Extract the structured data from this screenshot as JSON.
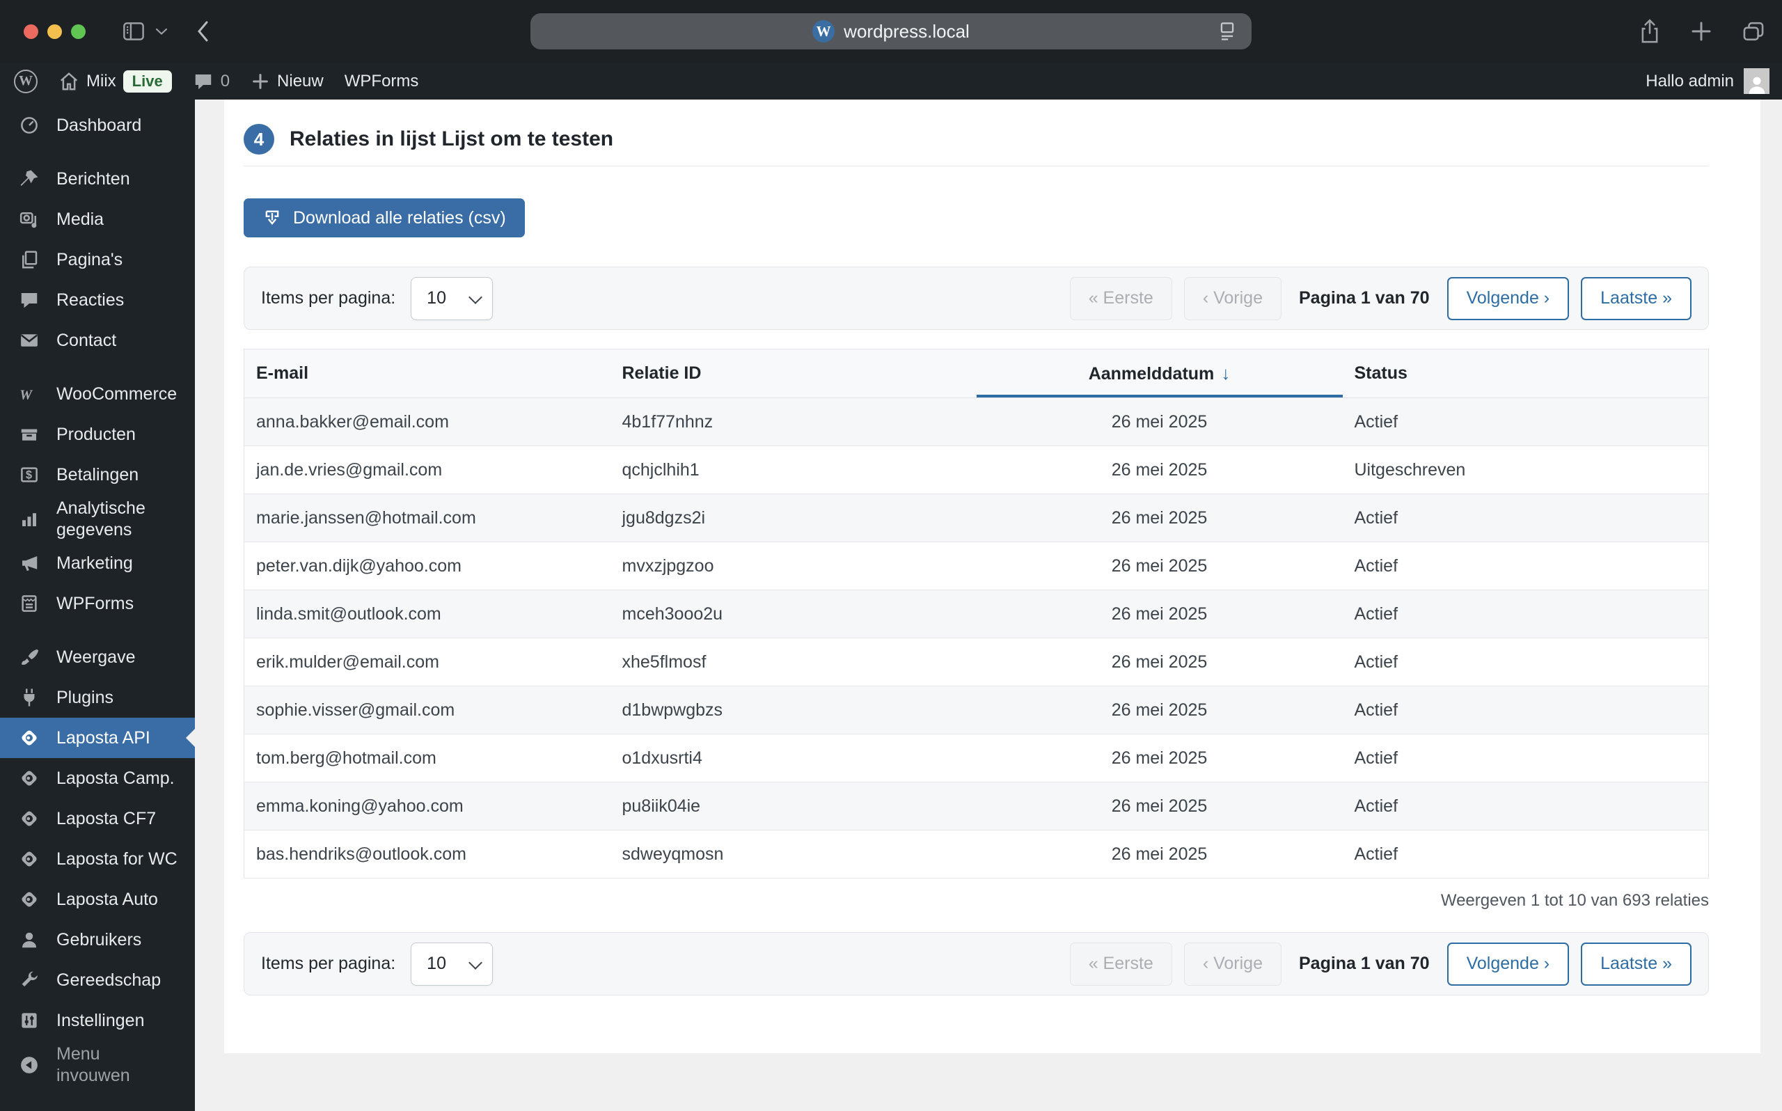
{
  "browser": {
    "url": "wordpress.local"
  },
  "admin_bar": {
    "site_name": "Miix",
    "live_badge": "Live",
    "comment_count": "0",
    "new_label": "Nieuw",
    "wpforms_label": "WPForms",
    "greeting": "Hallo admin"
  },
  "sidebar": {
    "items": [
      {
        "label": "Dashboard",
        "icon": "dashboard"
      },
      {
        "label": "Berichten",
        "icon": "pin",
        "gap_before": true
      },
      {
        "label": "Media",
        "icon": "media"
      },
      {
        "label": "Pagina's",
        "icon": "pages"
      },
      {
        "label": "Reacties",
        "icon": "bubble"
      },
      {
        "label": "Contact",
        "icon": "mail"
      },
      {
        "label": "WooCommerce",
        "icon": "woo",
        "gap_before": true
      },
      {
        "label": "Producten",
        "icon": "box"
      },
      {
        "label": "Betalingen",
        "icon": "payments"
      },
      {
        "label": "Analytische gegevens",
        "icon": "analytics"
      },
      {
        "label": "Marketing",
        "icon": "megaphone"
      },
      {
        "label": "WPForms",
        "icon": "wpforms"
      },
      {
        "label": "Weergave",
        "icon": "brush",
        "gap_before": true
      },
      {
        "label": "Plugins",
        "icon": "plug"
      },
      {
        "label": "Laposta API",
        "icon": "laposta",
        "active": true
      },
      {
        "label": "Laposta Camp.",
        "icon": "laposta"
      },
      {
        "label": "Laposta CF7",
        "icon": "laposta"
      },
      {
        "label": "Laposta for WC",
        "icon": "laposta"
      },
      {
        "label": "Laposta Auto",
        "icon": "laposta"
      },
      {
        "label": "Gebruikers",
        "icon": "user"
      },
      {
        "label": "Gereedschap",
        "icon": "wrench"
      },
      {
        "label": "Instellingen",
        "icon": "settings"
      },
      {
        "label": "Menu invouwen",
        "icon": "collapse",
        "dim": true
      }
    ]
  },
  "main": {
    "step_number": "4",
    "title": "Relaties in lijst Lijst om te testen",
    "download_button": "Download alle relaties (csv)",
    "pagination": {
      "items_per_page_label": "Items per pagina:",
      "items_per_page_value": "10",
      "first": "« Eerste",
      "prev": "‹ Vorige",
      "page_status": "Pagina 1 van 70",
      "next": "Volgende ›",
      "last": "Laatste »"
    },
    "table": {
      "columns": [
        "E-mail",
        "Relatie ID",
        "Aanmelddatum",
        "Status"
      ],
      "sorted_column": "Aanmelddatum",
      "sort_direction": "desc",
      "sort_arrow": "↓",
      "rows": [
        [
          "anna.bakker@email.com",
          "4b1f77nhnz",
          "26 mei 2025",
          "Actief"
        ],
        [
          "jan.de.vries@gmail.com",
          "qchjclhih1",
          "26 mei 2025",
          "Uitgeschreven"
        ],
        [
          "marie.janssen@hotmail.com",
          "jgu8dgzs2i",
          "26 mei 2025",
          "Actief"
        ],
        [
          "peter.van.dijk@yahoo.com",
          "mvxzjpgzoo",
          "26 mei 2025",
          "Actief"
        ],
        [
          "linda.smit@outlook.com",
          "mceh3ooo2u",
          "26 mei 2025",
          "Actief"
        ],
        [
          "erik.mulder@email.com",
          "xhe5flmosf",
          "26 mei 2025",
          "Actief"
        ],
        [
          "sophie.visser@gmail.com",
          "d1bwpwgbzs",
          "26 mei 2025",
          "Actief"
        ],
        [
          "tom.berg@hotmail.com",
          "o1dxusrti4",
          "26 mei 2025",
          "Actief"
        ],
        [
          "emma.koning@yahoo.com",
          "pu8iik04ie",
          "26 mei 2025",
          "Actief"
        ],
        [
          "bas.hendriks@outlook.com",
          "sdweyqmosn",
          "26 mei 2025",
          "Actief"
        ]
      ]
    },
    "results_summary": "Weergeven 1 tot 10 van 693 relaties"
  },
  "colors": {
    "accent_blue": "#3a6da5",
    "link_blue": "#2e6da4",
    "chrome_bg": "#1e2124",
    "admin_dark": "#1d2327",
    "page_bg": "#f0f0f1",
    "stripe_bg": "#f6f7f8",
    "live_green": "#2a6b35"
  }
}
